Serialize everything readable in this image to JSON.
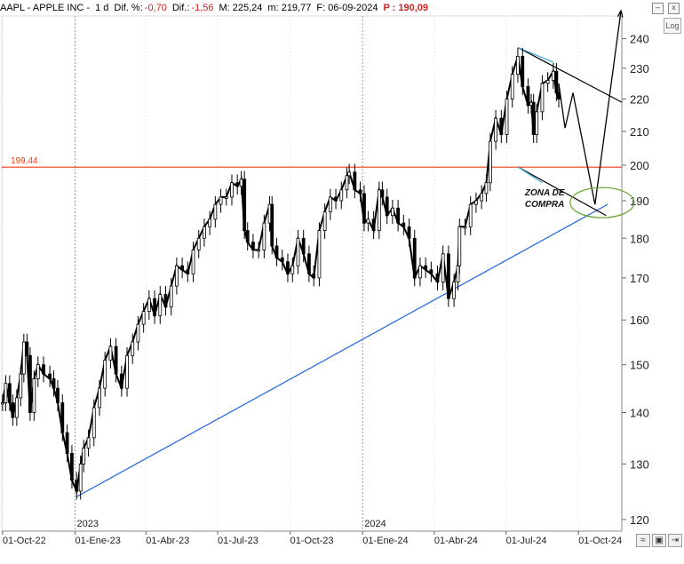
{
  "header": {
    "symbol": "AAPL - APPLE INC -",
    "timeframe": "1 d",
    "dif_pct_label": "Dif. %:",
    "dif_pct_value": "-0,70",
    "dif_label": "Dif.:",
    "dif_value": "-1,56",
    "m_label": "M: 225,24",
    "mi_label": "m: 219,77",
    "date_label": "F: 06-09-2024",
    "p_label": "P : 190,09"
  },
  "controls": {
    "log_label": "Log",
    "minimize": "–",
    "close": "x"
  },
  "chart_data": {
    "type": "line",
    "title": "AAPL - APPLE INC -",
    "xlabel": "",
    "ylabel": "",
    "ylim": [
      118,
      248
    ],
    "y_scale": "log",
    "yticks": [
      120,
      130,
      140,
      150,
      160,
      170,
      180,
      190,
      200,
      210,
      220,
      230,
      240
    ],
    "ytick_labels": [
      "120",
      "130",
      "140",
      "150",
      "160",
      "170",
      "180",
      "190",
      "200",
      "210",
      "220",
      "230",
      "240"
    ],
    "xlim": [
      "2022-09-30",
      "2024-11-25"
    ],
    "xticks": [
      "2022-10-01",
      "2023-01-01",
      "2023-04-01",
      "2023-07-01",
      "2023-10-01",
      "2024-01-01",
      "2024-04-01",
      "2024-07-01",
      "2024-10-01"
    ],
    "xtick_labels": [
      "01-Oct-22",
      "01-Ene-23",
      "01-Abr-23",
      "01-Jul-23",
      "01-Oct-23",
      "01-Ene-24",
      "01-Abr-24",
      "01-Jul-24",
      "01-Oct-24"
    ],
    "year_markers": [
      {
        "date": "2023-01-01",
        "label": "2023"
      },
      {
        "date": "2024-01-01",
        "label": "2024"
      }
    ],
    "price_series": {
      "name": "AAPL",
      "style": "candlestick",
      "color": "#000000",
      "points": [
        [
          "2022-10-01",
          142
        ],
        [
          "2022-10-05",
          146
        ],
        [
          "2022-10-10",
          142
        ],
        [
          "2022-10-14",
          139
        ],
        [
          "2022-10-19",
          143
        ],
        [
          "2022-10-24",
          148
        ],
        [
          "2022-10-28",
          155
        ],
        [
          "2022-11-01",
          152
        ],
        [
          "2022-11-05",
          140
        ],
        [
          "2022-11-10",
          147
        ],
        [
          "2022-11-15",
          150
        ],
        [
          "2022-11-22",
          148
        ],
        [
          "2022-11-30",
          147
        ],
        [
          "2022-12-05",
          145
        ],
        [
          "2022-12-10",
          142
        ],
        [
          "2022-12-16",
          136
        ],
        [
          "2022-12-22",
          132
        ],
        [
          "2022-12-28",
          127
        ],
        [
          "2023-01-03",
          125
        ],
        [
          "2023-01-08",
          130
        ],
        [
          "2023-01-12",
          133
        ],
        [
          "2023-01-18",
          135
        ],
        [
          "2023-01-25",
          141
        ],
        [
          "2023-02-01",
          145
        ],
        [
          "2023-02-08",
          151
        ],
        [
          "2023-02-15",
          154
        ],
        [
          "2023-02-22",
          148
        ],
        [
          "2023-03-01",
          145
        ],
        [
          "2023-03-08",
          152
        ],
        [
          "2023-03-15",
          155
        ],
        [
          "2023-03-22",
          159
        ],
        [
          "2023-03-29",
          162
        ],
        [
          "2023-04-05",
          165
        ],
        [
          "2023-04-12",
          161
        ],
        [
          "2023-04-19",
          166
        ],
        [
          "2023-04-26",
          163
        ],
        [
          "2023-05-03",
          168
        ],
        [
          "2023-05-10",
          173
        ],
        [
          "2023-05-17",
          172
        ],
        [
          "2023-05-24",
          171
        ],
        [
          "2023-05-31",
          177
        ],
        [
          "2023-06-07",
          180
        ],
        [
          "2023-06-14",
          183
        ],
        [
          "2023-06-21",
          185
        ],
        [
          "2023-06-28",
          189
        ],
        [
          "2023-07-05",
          191
        ],
        [
          "2023-07-12",
          191
        ],
        [
          "2023-07-19",
          195
        ],
        [
          "2023-07-26",
          194
        ],
        [
          "2023-07-31",
          196
        ],
        [
          "2023-08-04",
          182
        ],
        [
          "2023-08-08",
          179
        ],
        [
          "2023-08-15",
          177
        ],
        [
          "2023-08-22",
          177
        ],
        [
          "2023-08-29",
          184
        ],
        [
          "2023-09-05",
          189
        ],
        [
          "2023-09-08",
          178
        ],
        [
          "2023-09-14",
          175
        ],
        [
          "2023-09-21",
          174
        ],
        [
          "2023-09-28",
          171
        ],
        [
          "2023-10-04",
          173
        ],
        [
          "2023-10-11",
          180
        ],
        [
          "2023-10-18",
          176
        ],
        [
          "2023-10-25",
          171
        ],
        [
          "2023-10-31",
          170
        ],
        [
          "2023-11-07",
          182
        ],
        [
          "2023-11-14",
          187
        ],
        [
          "2023-11-21",
          191
        ],
        [
          "2023-11-28",
          190
        ],
        [
          "2023-12-05",
          193
        ],
        [
          "2023-12-12",
          197
        ],
        [
          "2023-12-15",
          198
        ],
        [
          "2023-12-22",
          193
        ],
        [
          "2023-12-29",
          192
        ],
        [
          "2024-01-03",
          184
        ],
        [
          "2024-01-08",
          185
        ],
        [
          "2024-01-15",
          182
        ],
        [
          "2024-01-22",
          193
        ],
        [
          "2024-01-26",
          191
        ],
        [
          "2024-02-01",
          186
        ],
        [
          "2024-02-08",
          188
        ],
        [
          "2024-02-15",
          184
        ],
        [
          "2024-02-22",
          183
        ],
        [
          "2024-02-29",
          180
        ],
        [
          "2024-03-07",
          170
        ],
        [
          "2024-03-14",
          173
        ],
        [
          "2024-03-21",
          172
        ],
        [
          "2024-03-28",
          171
        ],
        [
          "2024-04-05",
          169
        ],
        [
          "2024-04-12",
          176
        ],
        [
          "2024-04-19",
          165
        ],
        [
          "2024-04-26",
          169
        ],
        [
          "2024-05-01",
          173
        ],
        [
          "2024-05-03",
          183
        ],
        [
          "2024-05-10",
          183
        ],
        [
          "2024-05-17",
          189
        ],
        [
          "2024-05-24",
          190
        ],
        [
          "2024-05-31",
          192
        ],
        [
          "2024-06-06",
          195
        ],
        [
          "2024-06-11",
          207
        ],
        [
          "2024-06-18",
          214
        ],
        [
          "2024-06-25",
          209
        ],
        [
          "2024-07-02",
          220
        ],
        [
          "2024-07-09",
          228
        ],
        [
          "2024-07-16",
          234
        ],
        [
          "2024-07-22",
          224
        ],
        [
          "2024-07-29",
          218
        ],
        [
          "2024-08-02",
          219
        ],
        [
          "2024-08-05",
          209
        ],
        [
          "2024-08-09",
          216
        ],
        [
          "2024-08-16",
          225
        ],
        [
          "2024-08-23",
          226
        ],
        [
          "2024-08-30",
          229
        ],
        [
          "2024-09-03",
          222
        ],
        [
          "2024-09-06",
          220
        ]
      ]
    },
    "projection": {
      "color": "#000000",
      "points": [
        [
          "2024-09-06",
          225
        ],
        [
          "2024-09-14",
          211
        ],
        [
          "2024-09-24",
          222
        ],
        [
          "2024-10-22",
          189
        ],
        [
          "2024-11-24",
          250
        ]
      ]
    },
    "horizontal_line": {
      "value": 199.44,
      "label": "199,44",
      "color": "#f03c14"
    },
    "trendlines": [
      {
        "name": "support-long",
        "color": "#1e64dc",
        "from": [
          "2023-01-03",
          124
        ],
        "to": [
          "2024-11-07",
          189
        ]
      },
      {
        "name": "channel-upper",
        "color": "#000000",
        "from": [
          "2024-07-16",
          237
        ],
        "to": [
          "2024-11-25",
          219
        ]
      },
      {
        "name": "channel-lower",
        "color": "#000000",
        "from": [
          "2024-07-16",
          199.5
        ],
        "to": [
          "2024-11-05",
          186
        ]
      },
      {
        "name": "channel-upper-highlight",
        "color": "#40a8d8",
        "from": [
          "2024-07-16",
          237
        ],
        "to": [
          "2024-08-30",
          232
        ]
      },
      {
        "name": "channel-lower-highlight",
        "color": "#40a8d8",
        "from": [
          "2024-07-16",
          199.5
        ],
        "to": [
          "2024-08-16",
          195
        ]
      }
    ],
    "annotations": [
      {
        "text": "ZONA DE",
        "date": "2024-07-25",
        "value": 191.5
      },
      {
        "text": "COMPRA",
        "date": "2024-07-25",
        "value": 188.3
      }
    ],
    "ellipse": {
      "color": "#6aa83a",
      "center_date": "2024-10-31",
      "center_value": 189.5
    }
  }
}
